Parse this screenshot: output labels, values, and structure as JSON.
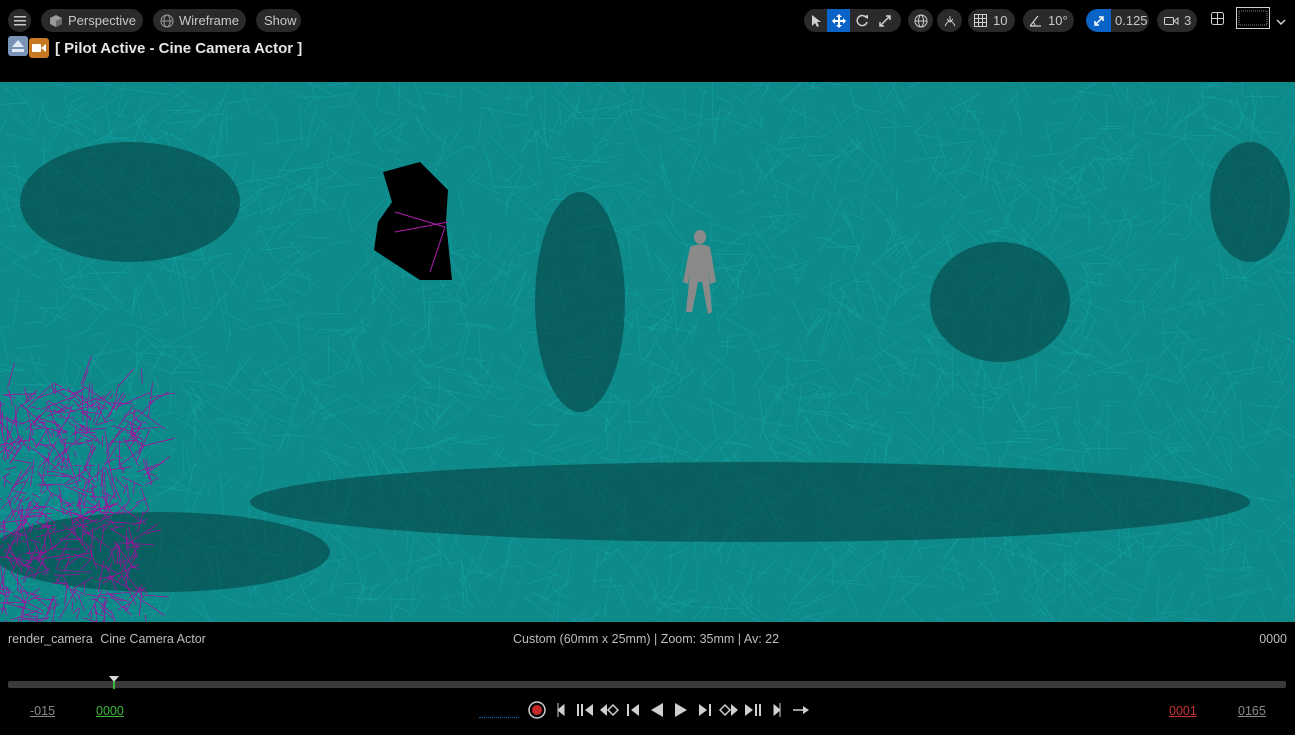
{
  "toolbar": {
    "perspective_label": "Perspective",
    "wireframe_label": "Wireframe",
    "show_label": "Show",
    "grid_size": "10",
    "rotation_snap": "10°",
    "scale_snap": "0.125",
    "camera_speed": "3"
  },
  "title": "[ Pilot Active - Cine Camera Actor ]",
  "info": {
    "camera_name": "render_camera",
    "camera_type": "Cine Camera Actor",
    "camera_details": "Custom (60mm x 25mm) | Zoom: 35mm | Av: 22",
    "current_frame": "0000"
  },
  "timeline": {
    "start_frame": "-015",
    "playback_start": "0000",
    "playback_end": "0001",
    "end_frame": "0165",
    "playhead_fraction": 0.083
  },
  "colors": {
    "accent": "#0a64c8",
    "wireframe": "#13a3a3",
    "wire_magenta": "#a012a0",
    "start_green": "#3cb83c",
    "end_red": "#c83232"
  }
}
